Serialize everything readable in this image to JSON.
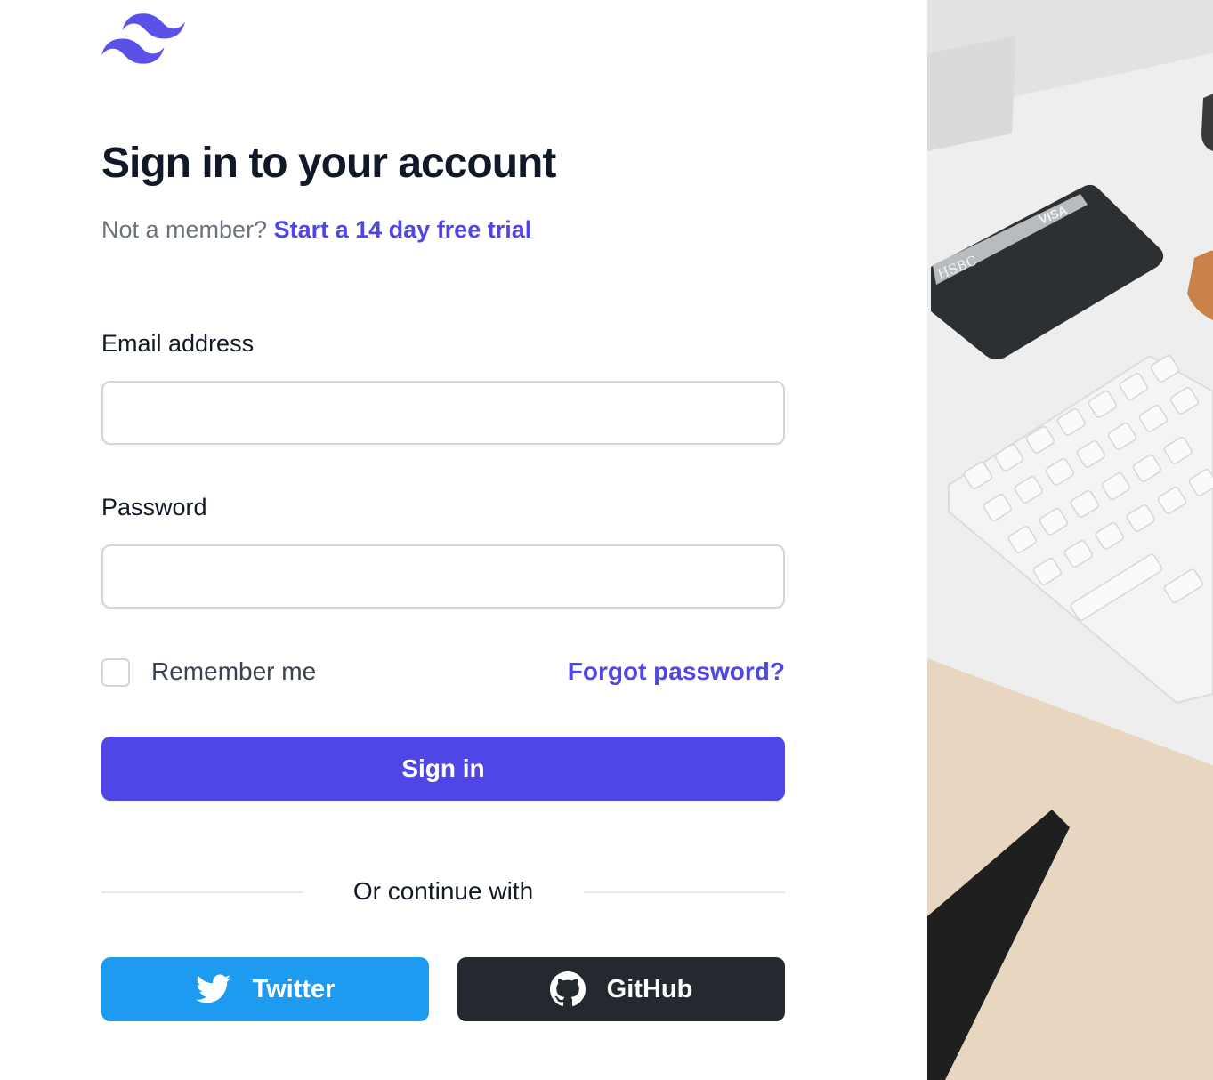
{
  "brand": {
    "logo_icon": "tailwind-wave-logo",
    "accent_color": "#4f46e5"
  },
  "header": {
    "title": "Sign in to your account",
    "subtitle_prefix": "Not a member?",
    "trial_link": "Start a 14 day free trial"
  },
  "form": {
    "email_label": "Email address",
    "email_value": "",
    "password_label": "Password",
    "password_value": "",
    "remember_label": "Remember me",
    "remember_checked": false,
    "forgot_link": "Forgot password?",
    "submit_label": "Sign in"
  },
  "social": {
    "divider_text": "Or continue with",
    "twitter_label": "Twitter",
    "twitter_icon": "twitter-bird-icon",
    "twitter_color": "#1d9bf0",
    "github_label": "GitHub",
    "github_icon": "github-icon",
    "github_color": "#24292f"
  },
  "side_image": {
    "card_texts": [
      "HSBC",
      "VISA"
    ]
  }
}
